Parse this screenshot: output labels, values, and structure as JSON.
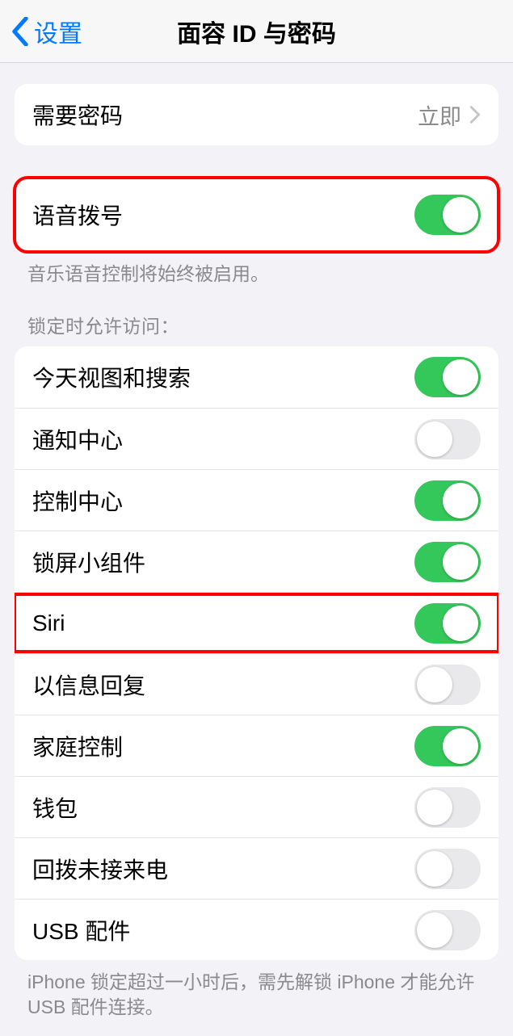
{
  "nav": {
    "back": "设置",
    "title": "面容 ID 与密码"
  },
  "require_passcode": {
    "label": "需要密码",
    "value": "立即"
  },
  "voice_dial": {
    "label": "语音拨号",
    "on": true,
    "note": "音乐语音控制将始终被启用。"
  },
  "lock_access": {
    "header": "锁定时允许访问：",
    "items": [
      {
        "label": "今天视图和搜索",
        "on": true,
        "highlight": false
      },
      {
        "label": "通知中心",
        "on": false,
        "highlight": false
      },
      {
        "label": "控制中心",
        "on": true,
        "highlight": false
      },
      {
        "label": "锁屏小组件",
        "on": true,
        "highlight": false
      },
      {
        "label": "Siri",
        "on": true,
        "highlight": true
      },
      {
        "label": "以信息回复",
        "on": false,
        "highlight": false
      },
      {
        "label": "家庭控制",
        "on": true,
        "highlight": false
      },
      {
        "label": "钱包",
        "on": false,
        "highlight": false
      },
      {
        "label": "回拨未接来电",
        "on": false,
        "highlight": false
      },
      {
        "label": "USB 配件",
        "on": false,
        "highlight": false
      }
    ],
    "footer": "iPhone 锁定超过一小时后，需先解锁 iPhone 才能允许 USB 配件连接。"
  }
}
